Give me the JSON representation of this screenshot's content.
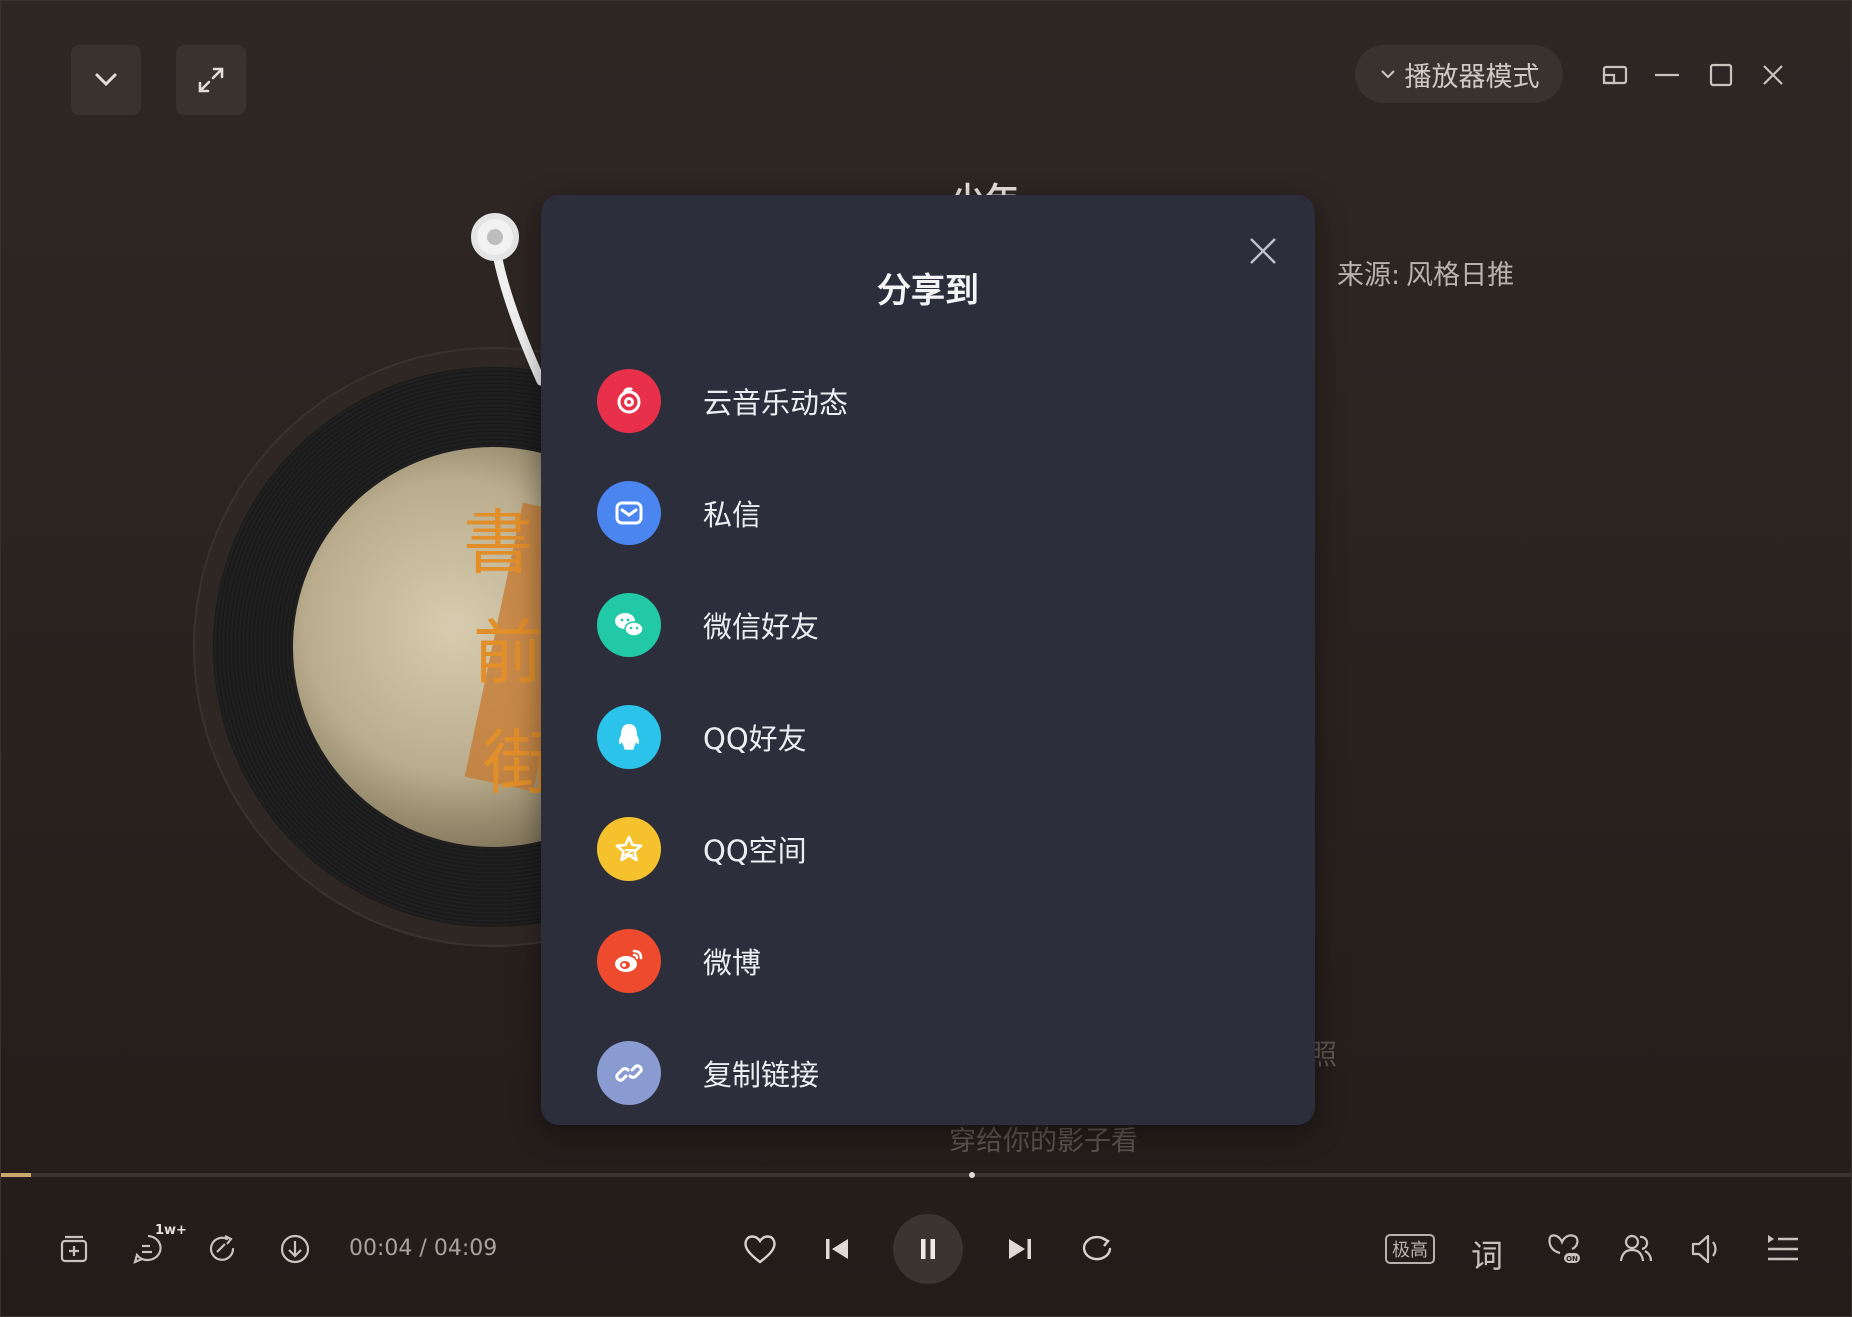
{
  "window": {
    "mode_button_label": "播放器模式"
  },
  "song": {
    "title": "少年",
    "source_label": "来源:",
    "source_value": "风格日推"
  },
  "lyrics": {
    "line_behind_1": "高照",
    "line_below": "穿给你的影子看"
  },
  "share_dialog": {
    "title": "分享到",
    "items": [
      {
        "label": "云音乐动态",
        "icon": "netease-music-icon",
        "color": "#e8304a"
      },
      {
        "label": "私信",
        "icon": "mail-icon",
        "color": "#4b86f0"
      },
      {
        "label": "微信好友",
        "icon": "wechat-icon",
        "color": "#22c9a6"
      },
      {
        "label": "QQ好友",
        "icon": "qq-icon",
        "color": "#2bc3ea"
      },
      {
        "label": "QQ空间",
        "icon": "qzone-star-icon",
        "color": "#f5c12c"
      },
      {
        "label": "微博",
        "icon": "weibo-icon",
        "color": "#ee4a2e"
      },
      {
        "label": "复制链接",
        "icon": "link-icon",
        "color": "#8a9bd1"
      }
    ]
  },
  "player": {
    "current_time": "00:04",
    "duration": "04:09",
    "time_separator": "/",
    "comment_badge": "1w+",
    "quality_label": "极高",
    "lyric_button": "词",
    "progress_fraction": 0.016
  },
  "colors": {
    "accent_progress": "#c9a86a",
    "dialog_bg": "#2c2e3b",
    "window_bg": "#2b2320"
  }
}
